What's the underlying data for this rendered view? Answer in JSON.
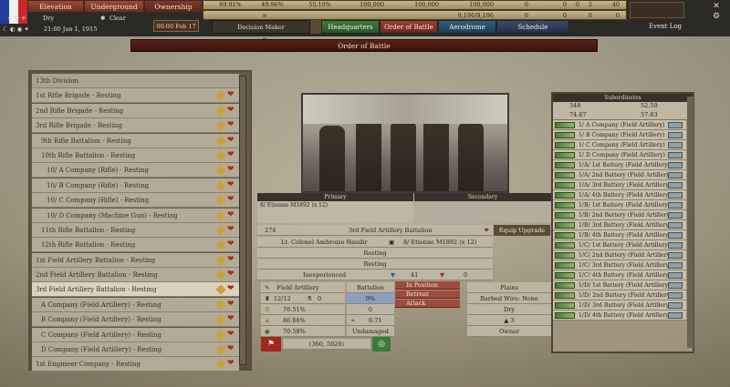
{
  "topbar": {
    "tabs": [
      "Elevation",
      "Underground",
      "Ownership"
    ],
    "weather": "Dry",
    "sky": "Clear",
    "datetime": "21:00 Jan 1, 1915",
    "clock": "00:00 Feb 17",
    "stats_row1": [
      "69.91%",
      "49.96%",
      "55.10%",
      "100,000",
      "100,000",
      "100,000",
      "0",
      "0",
      "0",
      "2",
      "40"
    ],
    "stats_row2": [
      "9,196/9,196",
      "0",
      "0",
      "0",
      "0"
    ],
    "decision_label": "Decision Maker",
    "nav": [
      "Headquarters",
      "Order of Battle",
      "Aerodrome",
      "Schedule"
    ],
    "event_log": "Event Log"
  },
  "page_title": "Order of Battle",
  "left_list": [
    {
      "label": "13th Division",
      "indent": 0,
      "head": true
    },
    {
      "label": "1st Rifle Brigade - Resting",
      "indent": 0
    },
    {
      "label": "2nd Rifle Brigade - Resting",
      "indent": 0
    },
    {
      "label": "3rd Rifle Brigade - Resting",
      "indent": 0
    },
    {
      "label": "9th Rifle Battalion - Resting",
      "indent": 1
    },
    {
      "label": "10th Rifle Battalion - Resting",
      "indent": 1
    },
    {
      "label": "10/ A Company (Rifle) - Resting",
      "indent": 2
    },
    {
      "label": "10/ B Company (Rifle) - Resting",
      "indent": 2
    },
    {
      "label": "10/ C Company (Rifle) - Resting",
      "indent": 2
    },
    {
      "label": "10/ D Company (Machine Gun) - Resting",
      "indent": 2
    },
    {
      "label": "11th Rifle Battalion - Resting",
      "indent": 1
    },
    {
      "label": "12th Rifle Battalion - Resting",
      "indent": 1
    },
    {
      "label": "1st Field Artillery Battalion - Resting",
      "indent": 0
    },
    {
      "label": "2nd Field Artillery Battalion - Resting",
      "indent": 0
    },
    {
      "label": "3rd Field Artillery Battalion - Resting",
      "indent": 0,
      "selected": true
    },
    {
      "label": "A Company (Field Artillery) - Resting",
      "indent": 1
    },
    {
      "label": "B Company (Field Artillery) - Resting",
      "indent": 1
    },
    {
      "label": "C Company (Field Artillery) - Resting",
      "indent": 1
    },
    {
      "label": "D Company (Field Artillery) - Resting",
      "indent": 1
    },
    {
      "label": "1st Engineer Company - Resting",
      "indent": 0
    }
  ],
  "weapons": {
    "primary": "Primary",
    "secondary": "Secondary",
    "primary_item": "8/ Etienne M1892 (x 12)"
  },
  "unit": {
    "number": "274",
    "name": "3rd Field Artillery Battalion",
    "equip_upgrade": "Equip Upgrade",
    "commander": "Lt. Colonel Ambroise Haudir",
    "weapon": "8/ Etienne M1892 (x 12)",
    "status1": "Resting",
    "status2": "Resting",
    "inexperience": "Inexperienced",
    "count_a": "41",
    "count_b": "0",
    "type": "Field Artillery",
    "size": "Battalion",
    "guns": "12/12",
    "g_val": "0",
    "pct": "0%",
    "morale": "70.51%",
    "morale_v": "0",
    "supply": "86.66%",
    "supply_v": "0.71",
    "fuel": "70.58%",
    "fuel_v": "Undamaged",
    "coords": "(360, 5020)"
  },
  "red_buttons": [
    "In Position",
    "Retreat",
    "Attack"
  ],
  "terrain": {
    "type": "Plains",
    "obstacle": "Barbed Wire: None",
    "ground": "Dry",
    "level": "3",
    "owner": "Owner"
  },
  "subordinates": {
    "title": "Subordinates",
    "s1": "348",
    "s2": "52.50",
    "s3": "74.67",
    "s4": "57.83",
    "items": [
      "1/ A Company (Field Artillery)",
      "1/ B Company (Field Artillery)",
      "1/ C Company (Field Artillery)",
      "1/ D Company (Field Artillery)",
      "1/A/ 1st Battery (Field Artillery)",
      "1/A/ 2nd Battery (Field Artillery)",
      "1/A/ 3rd Battery (Field Artillery)",
      "1/A/ 4th Battery (Field Artillery)",
      "1/B/ 1st Battery (Field Artillery)",
      "1/B/ 2nd Battery (Field Artillery)",
      "1/B/ 3rd Battery (Field Artillery)",
      "1/B/ 4th Battery (Field Artillery)",
      "1/C/ 1st Battery (Field Artillery)",
      "1/C/ 2nd Battery (Field Artillery)",
      "1/C/ 3rd Battery (Field Artillery)",
      "1/C/ 4th Battery (Field Artillery)",
      "1/D/ 1st Battery (Field Artillery)",
      "1/D/ 2nd Battery (Field Artillery)",
      "1/D/ 3rd Battery (Field Artillery)",
      "1/D/ 4th Battery (Field Artillery)"
    ]
  }
}
